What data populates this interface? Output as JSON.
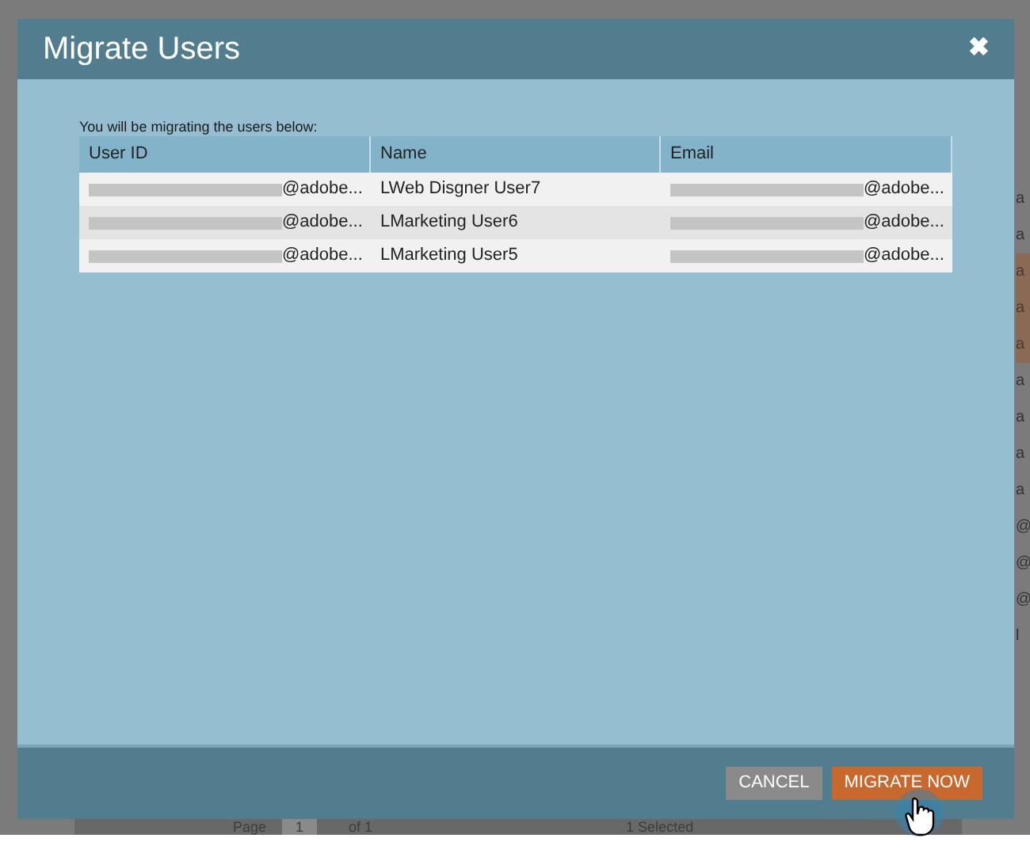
{
  "background": {
    "side_cells": [
      {
        "text": "a",
        "highlighted": false
      },
      {
        "text": "a",
        "highlighted": false
      },
      {
        "text": "a",
        "highlighted": true
      },
      {
        "text": "a",
        "highlighted": true
      },
      {
        "text": "a",
        "highlighted": true
      },
      {
        "text": "a",
        "highlighted": false
      },
      {
        "text": "a",
        "highlighted": false
      },
      {
        "text": "a",
        "highlighted": false
      },
      {
        "text": "a",
        "highlighted": false
      },
      {
        "text": "@",
        "highlighted": false
      },
      {
        "text": "@",
        "highlighted": false
      },
      {
        "text": "@",
        "highlighted": false
      },
      {
        "text": "l",
        "highlighted": false
      }
    ],
    "pager": {
      "page_label": "Page",
      "page_value": "1",
      "page_count": "of 1",
      "selection": "1 Selected"
    }
  },
  "dialog": {
    "title": "Migrate Users",
    "close": "✖",
    "intro": "You will be migrating the users below:",
    "table": {
      "columns": [
        "User ID",
        "Name",
        "Email"
      ],
      "rows": [
        {
          "user_id": "@adobe...",
          "name": "LWeb Disgner User7",
          "email": "@adobe..."
        },
        {
          "user_id": "@adobe...",
          "name": "LMarketing User6",
          "email": "@adobe..."
        },
        {
          "user_id": "@adobe...",
          "name": "LMarketing User5",
          "email": "@adobe..."
        }
      ]
    },
    "buttons": [
      {
        "label": "CANCEL",
        "kind": "secondary"
      },
      {
        "label": "MIGRATE NOW",
        "kind": "primary",
        "hovered": true
      }
    ]
  }
}
